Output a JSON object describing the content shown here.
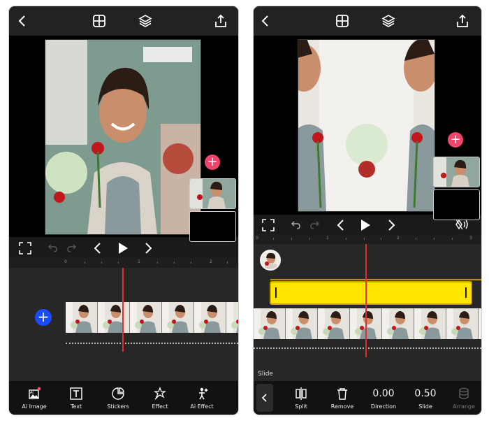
{
  "icons": {
    "back": "chevron-left-icon",
    "grid": "grid-icon",
    "layers": "layers-icon",
    "share": "share-icon"
  },
  "colors": {
    "accent_red": "#f0456b",
    "playhead": "#e52b2b",
    "add_blue": "#1a4cff",
    "slide_bar": "#ffe600"
  },
  "left": {
    "ruler_ticks": [
      "0",
      "1",
      "2"
    ],
    "toolbar": [
      {
        "label": "Ai Image",
        "icon": "ai-image-icon"
      },
      {
        "label": "Text",
        "icon": "text-icon"
      },
      {
        "label": "Stickers",
        "icon": "stickers-icon"
      },
      {
        "label": "Effect",
        "icon": "effect-icon"
      },
      {
        "label": "Ai Effect",
        "icon": "ai-effect-icon"
      }
    ]
  },
  "right": {
    "ruler_ticks": [
      "0",
      "1",
      "2",
      "3"
    ],
    "section_label": "Slide",
    "toolbar": {
      "split": "Split",
      "remove": "Remove",
      "direction_value": "0.00",
      "direction": "Direction",
      "slide_value": "0.50",
      "slide": "Slide",
      "arrange": "Arrange"
    }
  }
}
